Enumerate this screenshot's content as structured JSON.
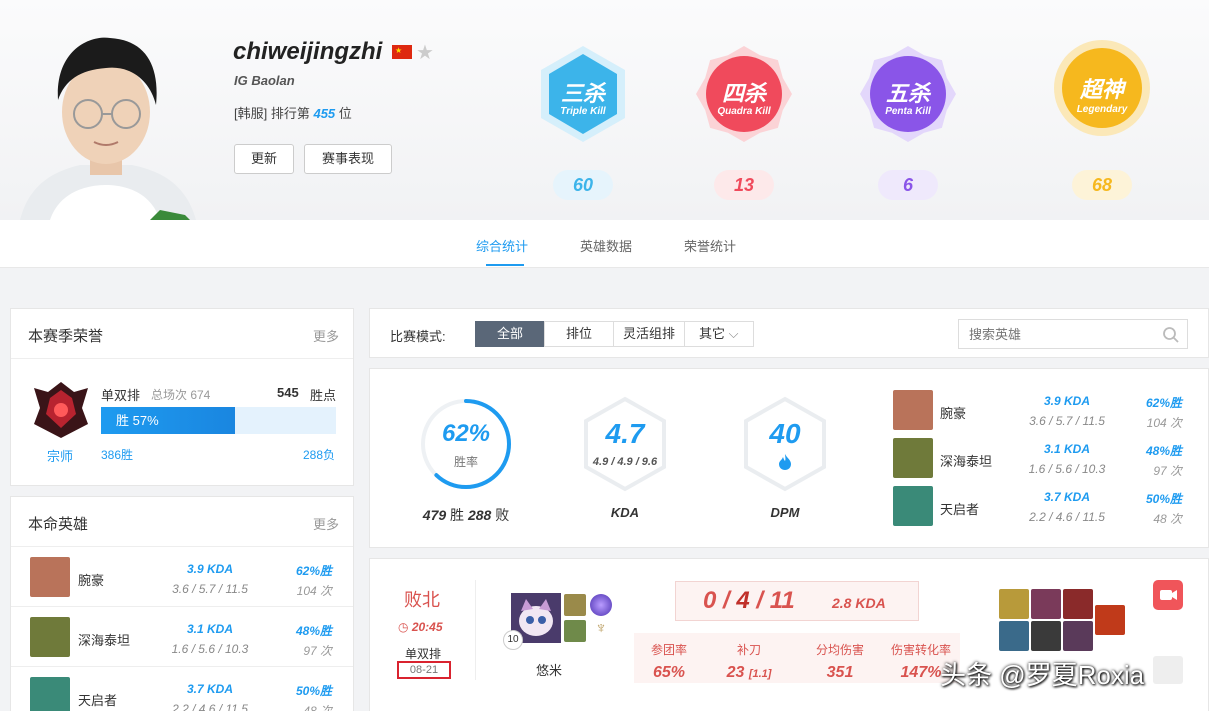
{
  "player": {
    "name": "chiweijingzhi",
    "team": "IG Baolan",
    "rank_prefix": "[韩服] 排行第",
    "rank_value": "455",
    "rank_suffix": "位",
    "update_label": "更新",
    "match_label": "赛事表现"
  },
  "badges": [
    {
      "title": "三杀",
      "subtitle": "Triple Kill",
      "count": "60",
      "color": "#3cb4ea"
    },
    {
      "title": "四杀",
      "subtitle": "Quadra Kill",
      "count": "13",
      "color": "#f04a5c"
    },
    {
      "title": "五杀",
      "subtitle": "Penta Kill",
      "count": "6",
      "color": "#8a55e8"
    },
    {
      "title": "超神",
      "subtitle": "Legendary",
      "count": "68",
      "color": "#f6b81e"
    }
  ],
  "tabs": [
    "综合统计",
    "英雄数据",
    "荣誉统计"
  ],
  "honor": {
    "title": "本赛季荣誉",
    "more": "更多",
    "queue": "单双排",
    "total_label": "总场次 674",
    "points": "545",
    "points_label": "胜点",
    "win_bar": "胜 57%",
    "win_rate_value": 0.57,
    "tier": "宗师",
    "wins": "386胜",
    "losses": "288负"
  },
  "heroes_panel": {
    "title": "本命英雄",
    "more": "更多"
  },
  "heroes": [
    {
      "name": "腕豪",
      "kda": "3.9 KDA",
      "kda_detail": "3.6 / 5.7 / 11.5",
      "wr": "62%胜",
      "games": "104 次",
      "color": "#b9735a"
    },
    {
      "name": "深海泰坦",
      "kda": "3.1 KDA",
      "kda_detail": "1.6 / 5.6 / 10.3",
      "wr": "48%胜",
      "games": "97 次",
      "color": "#6f7a3a"
    },
    {
      "name": "天启者",
      "kda": "3.7 KDA",
      "kda_detail": "2.2 / 4.6 / 11.5",
      "wr": "50%胜",
      "games": "48 次",
      "color": "#3a8a78"
    }
  ],
  "filter": {
    "label": "比赛模式:",
    "modes": [
      "全部",
      "排位",
      "灵活组排",
      "其它"
    ],
    "search_placeholder": "搜索英雄"
  },
  "summary": {
    "winrate": "62%",
    "winrate_label": "胜率",
    "winrate_value": 0.62,
    "record_w": "479",
    "record_w_label": "胜",
    "record_l": "288",
    "record_l_label": "败",
    "kda": "4.7",
    "kda_detail": "4.9 / 4.9 / 9.6",
    "kda_label": "KDA",
    "dpm": "40",
    "dpm_label": "DPM"
  },
  "match": {
    "result": "败北",
    "time": "20:45",
    "queue": "单双排",
    "date": "08-21",
    "champion": "悠米",
    "level": "10",
    "kda_k": "0",
    "kda_d": "4",
    "kda_a": "11",
    "kda_ratio": "2.8 KDA",
    "stats": [
      {
        "label": "参团率",
        "value": "65%"
      },
      {
        "label": "补刀",
        "value": "23",
        "sub": "[1.1]"
      },
      {
        "label": "分均伤害",
        "value": "351"
      },
      {
        "label": "伤害转化率",
        "value": "147%"
      }
    ]
  },
  "colors": {
    "accent": "#1e9bf0",
    "loss": "#d9534f"
  },
  "watermark": "头条 @罗夏Roxia"
}
